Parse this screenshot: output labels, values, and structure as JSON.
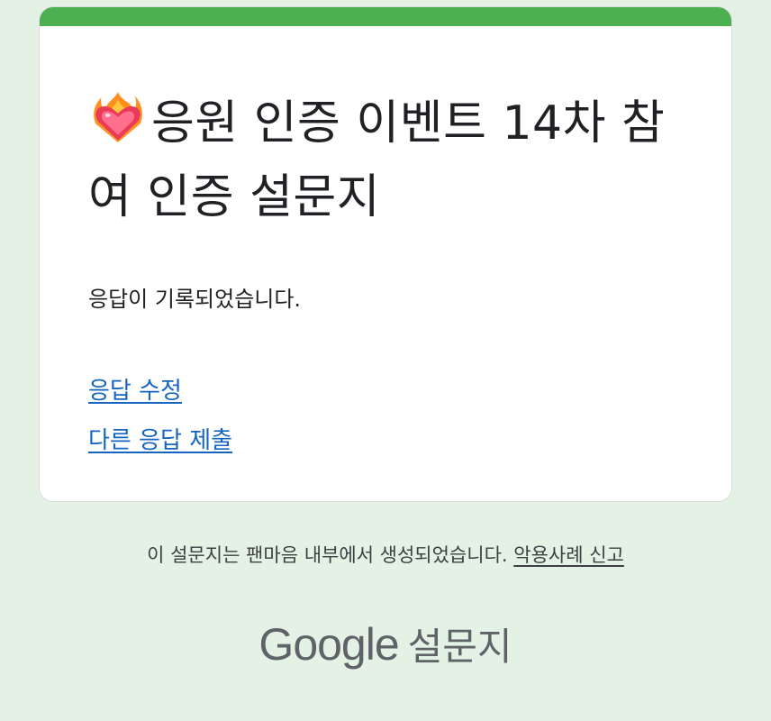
{
  "card": {
    "title": "응원 인증 이벤트 14차 참여 인증 설문지",
    "title_emoji": "heart-on-fire-emoji",
    "confirmation": "응답이 기록되었습니다.",
    "edit_link": "응답 수정",
    "another_link": "다른 응답 제출"
  },
  "footer": {
    "note": "이 설문지는 팬마음 내부에서 생성되었습니다.",
    "report_link": "악용사례 신고",
    "brand_google": "Google",
    "brand_forms": "설문지"
  },
  "colors": {
    "background": "#e4f2e6",
    "accent_bar": "#4caf50",
    "link": "#1565c0"
  }
}
